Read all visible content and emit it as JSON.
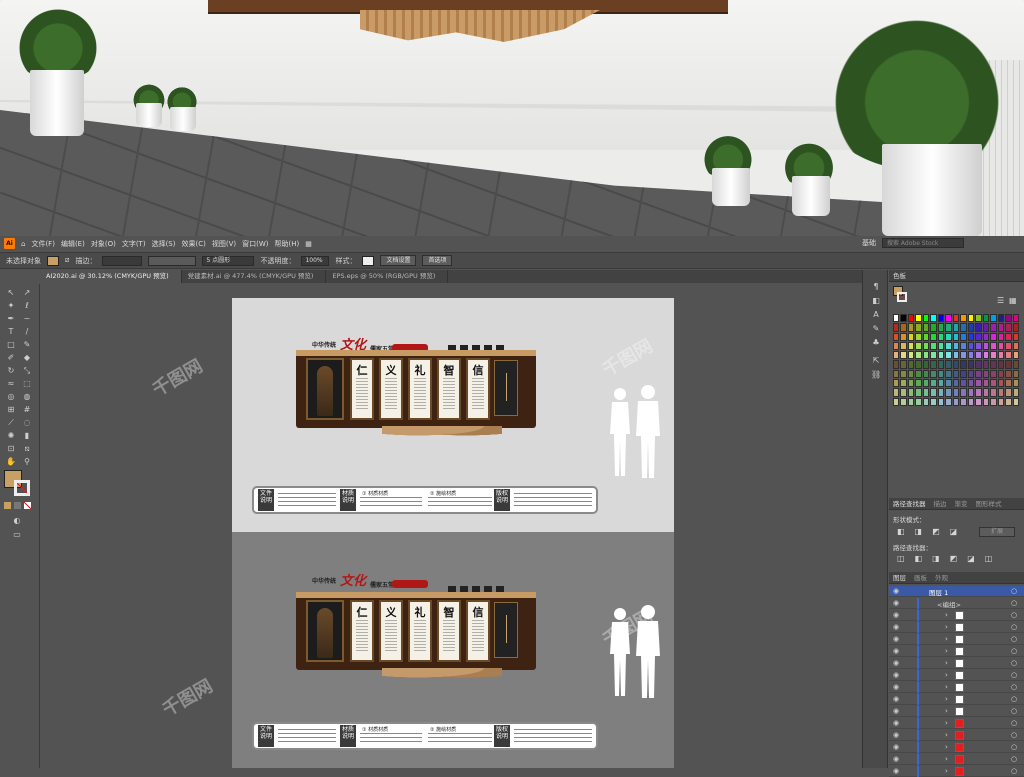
{
  "menubar": {
    "logo": "Ai",
    "items": [
      "文件(F)",
      "编辑(E)",
      "对象(O)",
      "文字(T)",
      "选择(S)",
      "效果(C)",
      "视图(V)",
      "窗口(W)",
      "帮助(H)"
    ],
    "workspace": "基础",
    "search_placeholder": "搜索 Adobe Stock"
  },
  "controlbar": {
    "selection": "未选择对象",
    "stroke_label": "描边：",
    "brush": "5 点圆形",
    "opacity_label": "不透明度：",
    "opacity": "100%",
    "style_label": "样式：",
    "doc_setup": "文档设置",
    "preferences": "首选项"
  },
  "tabs": [
    {
      "label": "AI2020.ai @ 30.12% (CMYK/GPU 预览)",
      "active": true
    },
    {
      "label": "党建素材.ai @ 477.4% (CMYK/GPU 预览)",
      "active": false
    },
    {
      "label": "EPS.eps @ 50% (RGB/GPU 预览)",
      "active": false
    }
  ],
  "artwork": {
    "header": "中华传统",
    "culture": "文化",
    "sub": "儒家五常",
    "chars": [
      "仁",
      "义",
      "礼",
      "智",
      "信"
    ],
    "info_labels": [
      "文件说明",
      "材质说明",
      "版权说明"
    ],
    "info_headings": [
      "① 材质材质",
      "② 施绘材质"
    ]
  },
  "panels": {
    "color_title": "色板",
    "pathfinder_tabs": [
      "路径查找器",
      "描边",
      "渐变",
      "图形样式"
    ],
    "shape_modes": "形状模式：",
    "expand": "扩展",
    "pathfinders": "路径查找器：",
    "layers_tabs": [
      "图层",
      "画板",
      "外观"
    ],
    "layer_name": "图层 1",
    "group_name": "<编组>"
  },
  "colors": {
    "accent": "#3a66d8",
    "wood": "#c79b63"
  },
  "watermark": "千图网"
}
